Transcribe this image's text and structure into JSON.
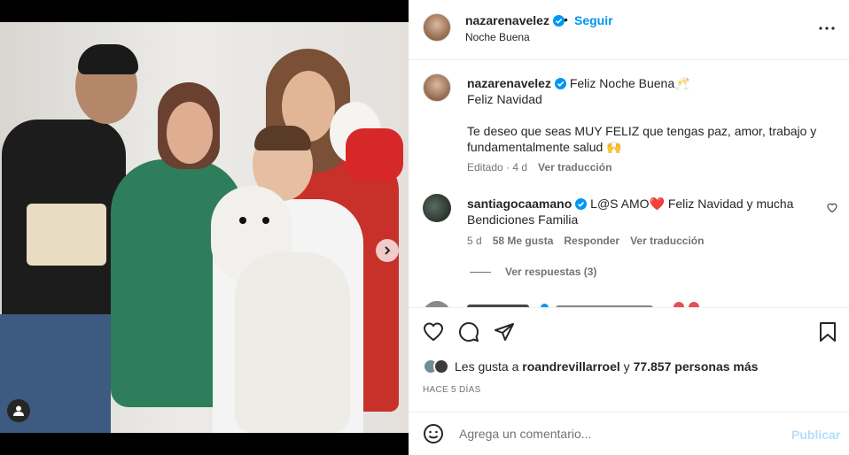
{
  "photo": {
    "carousel_dots": 7,
    "active_dot": 0
  },
  "header": {
    "username": "nazarenavelez",
    "separator": "•",
    "follow_label": "Seguir",
    "location": "Noche Buena"
  },
  "caption": {
    "username": "nazarenavelez",
    "title": "Feliz Noche Buena🥂",
    "line2": "Feliz Navidad",
    "body": "Te deseo que seas MUY FELIZ que tengas paz, amor, trabajo y fundamentalmente salud 🙌",
    "edited": "Editado · 4 d",
    "translate": "Ver traducción"
  },
  "comment": {
    "username": "santiagocaamano",
    "text": "L@S AMO❤️  Feliz Navidad y mucha Bendiciones Familia",
    "time": "5 d",
    "likes": "58 Me gusta",
    "reply": "Responder",
    "translate": "Ver traducción",
    "view_replies": "Ver respuestas (3)"
  },
  "likes": {
    "prefix": "Les gusta a",
    "user": "roandrevillarroel",
    "middle": "y",
    "count": "77.857 personas más"
  },
  "date": "HACE 5 DÍAS",
  "add_comment": {
    "placeholder": "Agrega un comentario...",
    "publish_label": "Publicar"
  },
  "colors": {
    "accent": "#0095f6",
    "publish_disabled": "#b2dffc",
    "secondary_text": "#737373",
    "heart_red": "#ed4956"
  }
}
